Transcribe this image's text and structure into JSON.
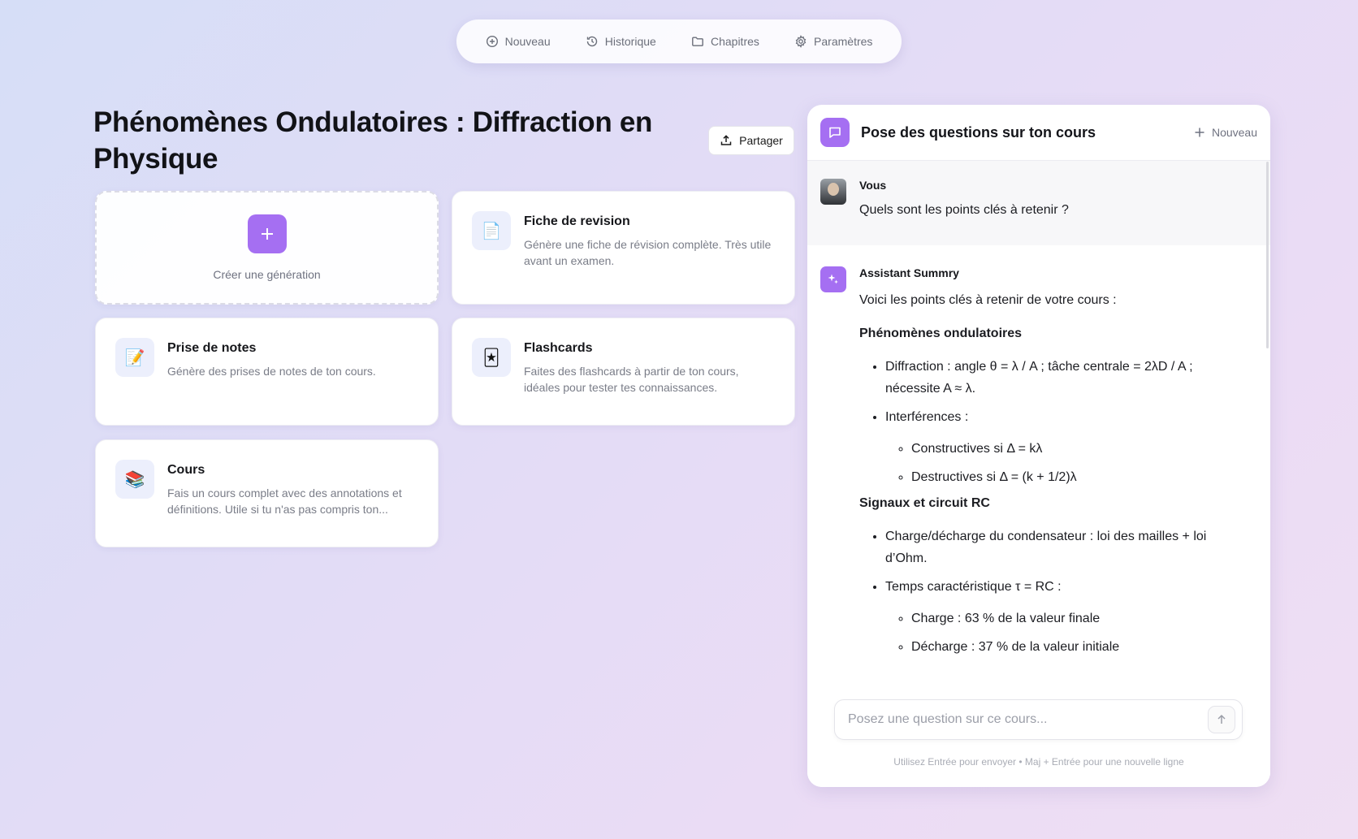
{
  "nav": {
    "items": [
      {
        "label": "Nouveau",
        "icon": "plus-circle-icon"
      },
      {
        "label": "Historique",
        "icon": "history-icon"
      },
      {
        "label": "Chapitres",
        "icon": "folder-icon"
      },
      {
        "label": "Paramètres",
        "icon": "gear-icon"
      }
    ]
  },
  "page": {
    "title": "Phénomènes Ondulatoires : Diffraction en Physique",
    "share_label": "Partager"
  },
  "cards": {
    "create_label": "Créer une génération",
    "items": [
      {
        "title": "Fiche de revision",
        "desc": "Génère une fiche de révision complète. Très utile avant un examen.",
        "icon": "document-icon",
        "glyph": "📄"
      },
      {
        "title": "Prise de notes",
        "desc": "Génère des prises de notes de ton cours.",
        "icon": "notepad-icon",
        "glyph": "📝"
      },
      {
        "title": "Flashcards",
        "desc": "Faites des flashcards à partir de ton cours, idéales pour tester tes connaissances.",
        "icon": "flashcards-icon",
        "glyph": "🃏"
      },
      {
        "title": "Cours",
        "desc": "Fais un cours complet avec des annotations et définitions. Utile si tu n'as pas compris ton...",
        "icon": "books-icon",
        "glyph": "📚"
      }
    ]
  },
  "chat": {
    "title": "Pose des questions sur ton cours",
    "new_label": "Nouveau",
    "user": {
      "author": "Vous",
      "text": "Quels sont les points clés à retenir ?"
    },
    "assistant": {
      "author": "Assistant Summry",
      "intro": "Voici les points clés à retenir de votre cours :",
      "section1": {
        "title": "Phénomènes ondulatoires",
        "b1": "Diffraction : angle θ = λ / A ; tâche centrale = 2λD / A ; nécessite A ≈ λ.",
        "b2": "Interférences :",
        "b2a": "Constructives si Δ = kλ",
        "b2b": "Destructives si Δ = (k + 1/2)λ"
      },
      "section2": {
        "title": "Signaux et circuit RC",
        "b1": "Charge/décharge du condensateur : loi des mailles + loi d’Ohm.",
        "b2": "Temps caractéristique τ = RC :",
        "b2a": "Charge : 63 % de la valeur finale",
        "b2b": "Décharge : 37 % de la valeur initiale"
      }
    },
    "input_placeholder": "Posez une question sur ce cours...",
    "hint": "Utilisez Entrée pour envoyer • Maj + Entrée pour une nouvelle ligne"
  },
  "colors": {
    "accent": "#a56ff2",
    "card_icon_bg": "#eceffc"
  }
}
